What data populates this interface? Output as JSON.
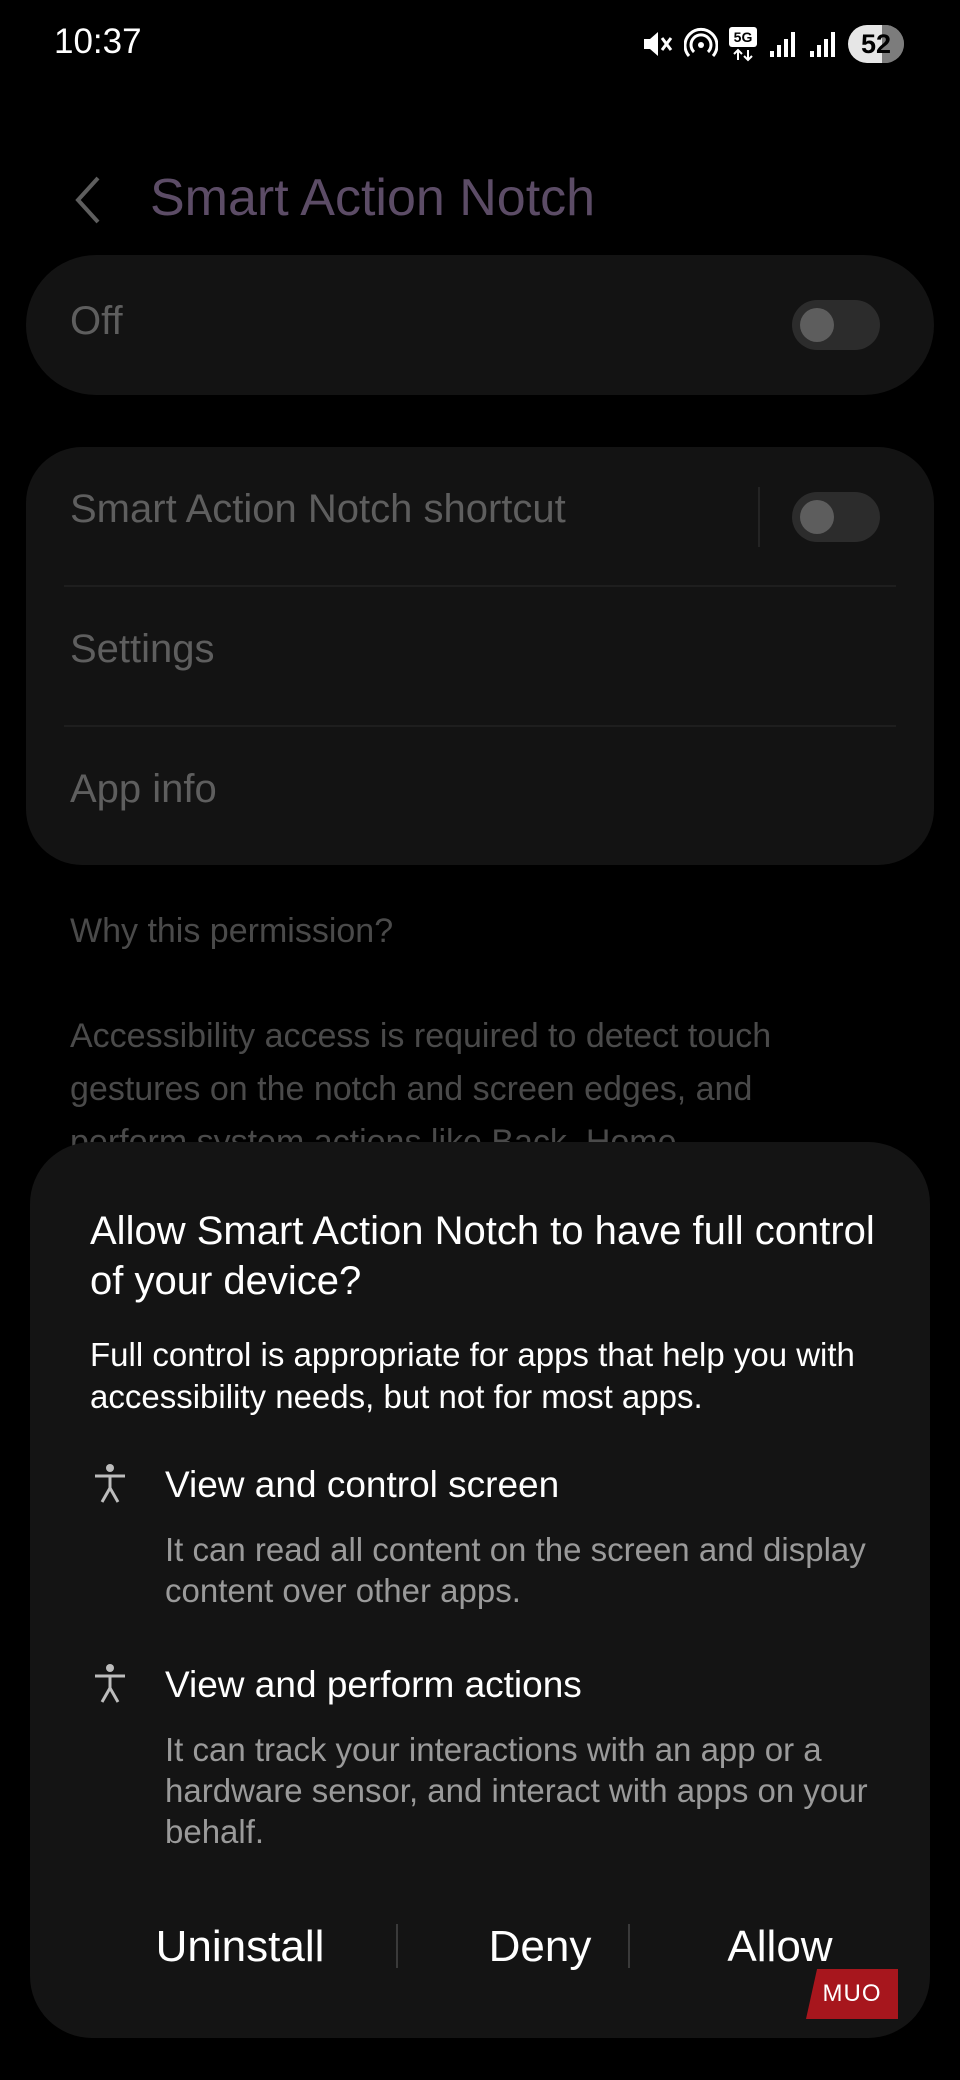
{
  "status_bar": {
    "time": "10:37",
    "battery": "52",
    "network": "5G"
  },
  "page": {
    "title": "Smart Action Notch",
    "master_toggle_label": "Off",
    "list": {
      "shortcut_label": "Smart Action Notch shortcut",
      "settings_label": "Settings",
      "app_info_label": "App info"
    },
    "why_heading": "Why this permission?",
    "why_lines": [
      "Accessibility access is required to detect touch",
      "gestures on the notch and screen edges, and",
      "perform system actions like Back, Home"
    ]
  },
  "dialog": {
    "title": "Allow Smart Action Notch to have full control of your device?",
    "description": "Full control is appropriate for apps that help you with accessibility needs, but not for most apps.",
    "permissions": [
      {
        "icon": "accessibility-icon",
        "title": "View and control screen",
        "description": "It can read all content on the screen and display content over other apps."
      },
      {
        "icon": "accessibility-icon",
        "title": "View and perform actions",
        "description": "It can track your interactions with an app or a hardware sensor, and interact with apps on your behalf."
      }
    ],
    "buttons": {
      "uninstall": "Uninstall",
      "deny": "Deny",
      "allow": "Allow"
    }
  },
  "watermark": "MUO",
  "colors": {
    "background": "#000000",
    "card": "#131313",
    "dialog": "#141414",
    "title_dim": "#5c4c66",
    "watermark": "#a7161d"
  }
}
